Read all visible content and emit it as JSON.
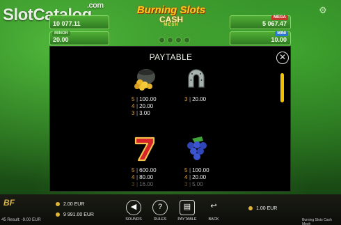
{
  "watermark": "SlotCatalog",
  "watermark_dot": ".com",
  "logo": {
    "line1": "Burning Slots",
    "line2": "CASH",
    "line3": "MESH"
  },
  "panels": {
    "left_top": {
      "value": "10 077.11"
    },
    "left_bottom": {
      "tag": "MINOR",
      "value": "20.00"
    },
    "right_top": {
      "tag": "MEGA",
      "value": "5 067.47"
    },
    "right_bottom": {
      "tag": "MINI",
      "value": "10.00"
    }
  },
  "paytable": {
    "title": "PAYTABLE",
    "close_label": "✕",
    "symbols": [
      {
        "name": "pot-of-gold",
        "pays": [
          {
            "count": "5",
            "amount": "100.00"
          },
          {
            "count": "4",
            "amount": "20.00"
          },
          {
            "count": "3",
            "amount": "3.00"
          }
        ]
      },
      {
        "name": "horseshoe",
        "pays": [
          {
            "count": "3",
            "amount": "20.00"
          }
        ]
      },
      {
        "name": "seven",
        "pays": [
          {
            "count": "5",
            "amount": "600.00"
          },
          {
            "count": "4",
            "amount": "80.00"
          },
          {
            "count": "3",
            "amount": "16.00"
          }
        ]
      },
      {
        "name": "grapes",
        "pays": [
          {
            "count": "5",
            "amount": "100.00"
          },
          {
            "count": "4",
            "amount": "20.00"
          },
          {
            "count": "3",
            "amount": "5.00"
          }
        ]
      }
    ]
  },
  "bottom": {
    "provider": "BF",
    "result": "45 Result: -9.00 EUR",
    "bet": "2.00 EUR",
    "balance": "9 991.00 EUR",
    "buttons": {
      "sounds": "SOUNDS",
      "rules": "RULES",
      "paytable": "PAYTABLE",
      "back": "BACK"
    },
    "coin_value": "1.00 EUR",
    "game_name": "Burning Slots Cash Mesh"
  },
  "colors": {
    "accent": "#f2c200",
    "table_green": "#2b7a21"
  }
}
